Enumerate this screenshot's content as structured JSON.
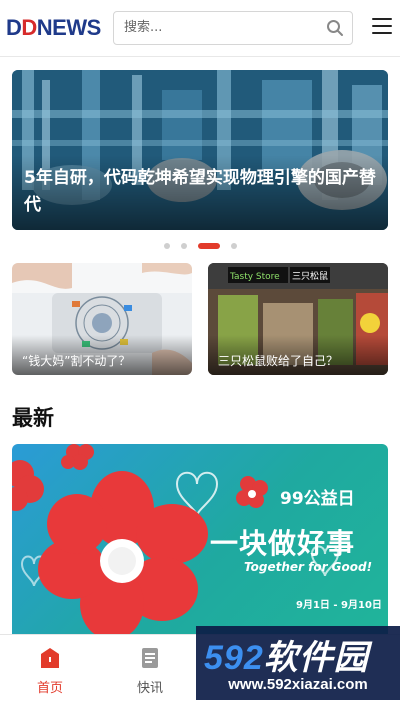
{
  "header": {
    "logo": {
      "d1": "D",
      "d2": "D",
      "rest": "NEWS"
    },
    "search_placeholder": "搜索...",
    "search_icon": "search-icon",
    "menu_icon": "hamburger-menu-icon"
  },
  "carousel": {
    "title": "5年自研，代码乾坤希望实现物理引擎的国产替代",
    "slide_count": 4,
    "active_index": 2
  },
  "cards": [
    {
      "caption": "“钱大妈”割不动了？"
    },
    {
      "caption": "三只松鼠败给了自己？"
    }
  ],
  "latest": {
    "heading": "最新",
    "banner": {
      "tag": "99公益日",
      "headline": "一块做好事",
      "slogan": "Together for Good!",
      "dates": "9月1日 - 9月10日"
    }
  },
  "store_sign": "三只松鼠",
  "bottom_nav": [
    {
      "label": "首页",
      "icon": "home-icon",
      "active": true
    },
    {
      "label": "快讯",
      "icon": "document-icon",
      "active": false
    }
  ],
  "watermark": {
    "brand_num": "592",
    "brand_text": "软件园",
    "url": "www.592xiazai.com"
  },
  "colors": {
    "accent": "#e23b2b",
    "logo_blue": "#1f3a8a",
    "banner_teal": "#20b59a"
  }
}
